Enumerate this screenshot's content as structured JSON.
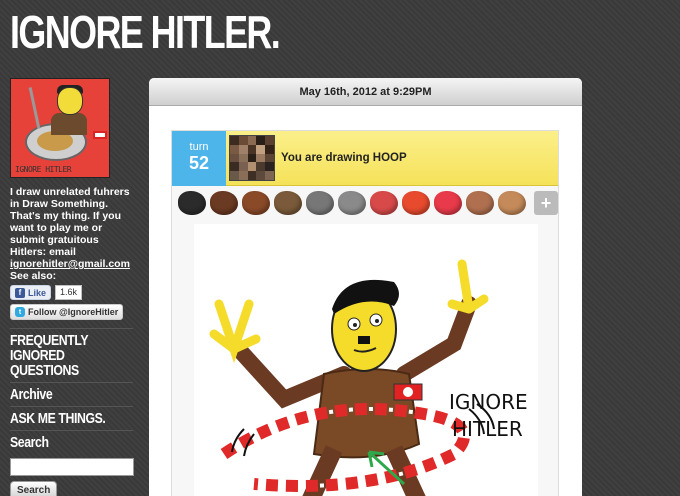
{
  "blog": {
    "title": "IGNORE HITLER."
  },
  "sidebar": {
    "avatar_caption": "IGNORE HITLER",
    "bio": "I draw unrelated fuhrers in Draw Something. That's my thing. If you want to play me or submit gratuitous Hitlers: email",
    "email": "ignorehitler@gmail.com",
    "see_also": "See also:",
    "fb_like_label": "Like",
    "fb_like_count": "1.6k",
    "twitter_follow_label": "Follow @IgnoreHitler",
    "nav": [
      {
        "label": "FREQUENTLY IGNORED QUESTIONS"
      },
      {
        "label": "Archive"
      },
      {
        "label": "ASK ME THINGS."
      },
      {
        "label": "Search"
      }
    ],
    "search_button": "Search"
  },
  "post": {
    "date": "May 16th, 2012 at 9:29PM",
    "game": {
      "turn_label": "turn",
      "turn_number": "52",
      "prompt": "You are drawing HOOP",
      "palette_colors": [
        "#2b2b2b",
        "#6b3a22",
        "#8a4a28",
        "#7a5a3a",
        "#777777",
        "#8a8a8a",
        "#d84a4a",
        "#e84a2e",
        "#e83a4a",
        "#b07050",
        "#c48a5a"
      ],
      "drawing_text": "IGNORE HITLER"
    }
  },
  "colors": {
    "accent_blue": "#4db5ea",
    "prompt_yellow": "#f5e25a",
    "background": "#3b3b3b"
  }
}
